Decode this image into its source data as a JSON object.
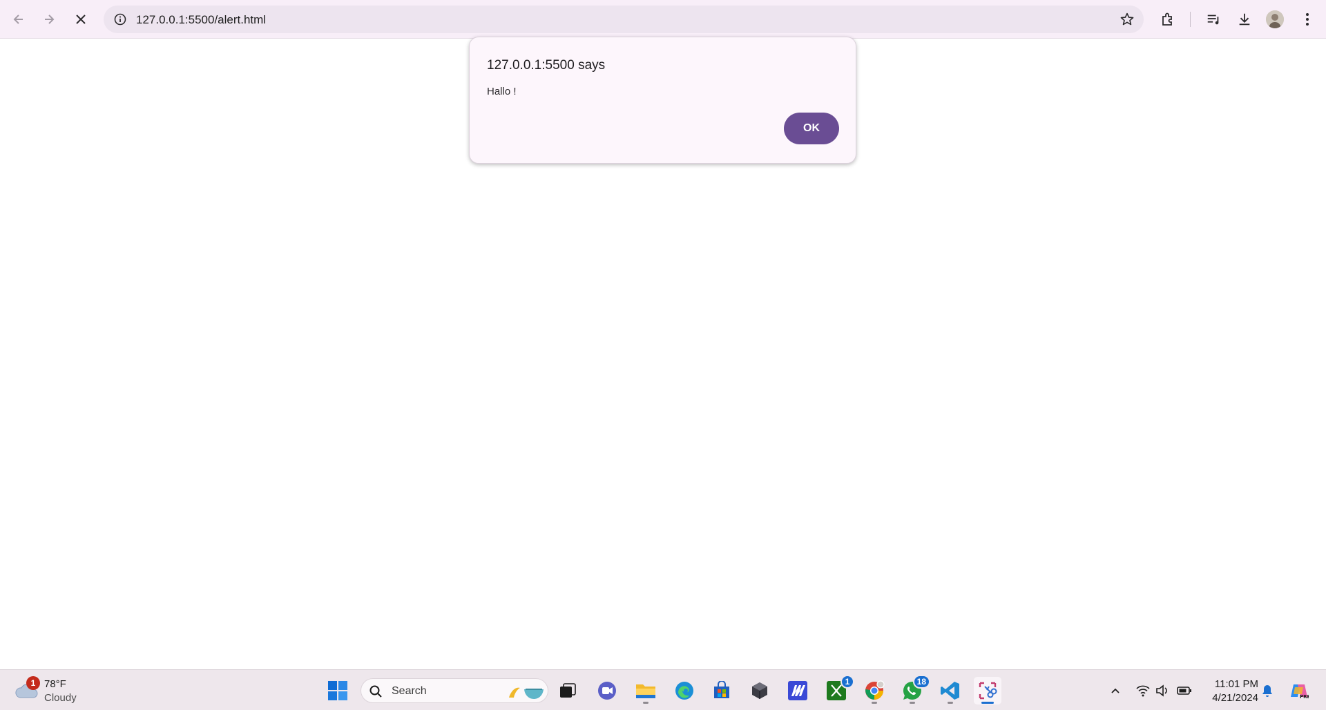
{
  "browser": {
    "url": "127.0.0.1:5500/alert.html",
    "back_icon": "back-arrow-icon",
    "forward_icon": "forward-arrow-icon",
    "stop_icon": "close-icon"
  },
  "dialog": {
    "title": "127.0.0.1:5500 says",
    "message": "Hallo !",
    "ok_label": "OK",
    "accent": "#6a4d94"
  },
  "taskbar": {
    "weather": {
      "temp": "78°F",
      "condition": "Cloudy",
      "badge": "1"
    },
    "search_placeholder": "Search",
    "apps": [
      {
        "name": "start",
        "icon": "windows-icon"
      },
      {
        "name": "task-view",
        "icon": "task-view-icon"
      },
      {
        "name": "meet",
        "icon": "video-chat-icon"
      },
      {
        "name": "file-explorer",
        "icon": "folder-icon"
      },
      {
        "name": "edge",
        "icon": "edge-icon"
      },
      {
        "name": "store",
        "icon": "store-icon"
      },
      {
        "name": "app-cube",
        "icon": "cube-icon"
      },
      {
        "name": "app-m",
        "icon": "m-app-icon"
      },
      {
        "name": "xbox",
        "icon": "xbox-icon",
        "badge": "1"
      },
      {
        "name": "chrome",
        "icon": "chrome-icon"
      },
      {
        "name": "whatsapp",
        "icon": "whatsapp-icon",
        "badge": "18"
      },
      {
        "name": "vscode",
        "icon": "vscode-icon"
      },
      {
        "name": "snipping-tool",
        "icon": "snipping-tool-icon"
      }
    ],
    "clock": {
      "time": "11:01 PM",
      "date": "4/21/2024"
    }
  }
}
